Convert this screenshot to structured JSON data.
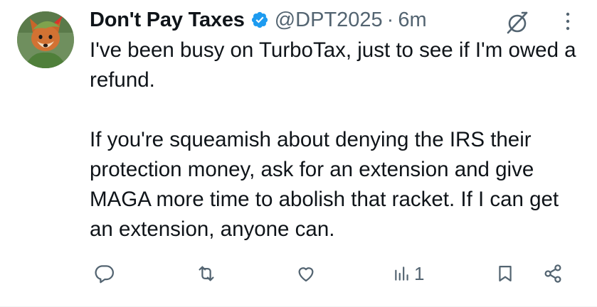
{
  "tweet": {
    "display_name": "Don't Pay Taxes",
    "handle": "@DPT2025",
    "separator": "·",
    "time": "6m",
    "text": "I've been busy on TurboTax, just to see if I'm owed a refund.\n\nIf you're squeamish about denying the IRS their protection money, ask for an extension and give MAGA more time to abolish that racket. If I can get an extension, anyone can."
  },
  "actions": {
    "reply": {
      "icon": "reply-icon"
    },
    "retweet": {
      "icon": "retweet-icon"
    },
    "like": {
      "icon": "heart-icon"
    },
    "views": {
      "icon": "views-icon",
      "count": "1"
    },
    "bookmark": {
      "icon": "bookmark-icon"
    },
    "share": {
      "icon": "share-icon"
    }
  },
  "colors": {
    "text": "#0f1419",
    "secondary": "#536471",
    "verified": "#1d9bf0",
    "divider": "#eff3f4"
  }
}
